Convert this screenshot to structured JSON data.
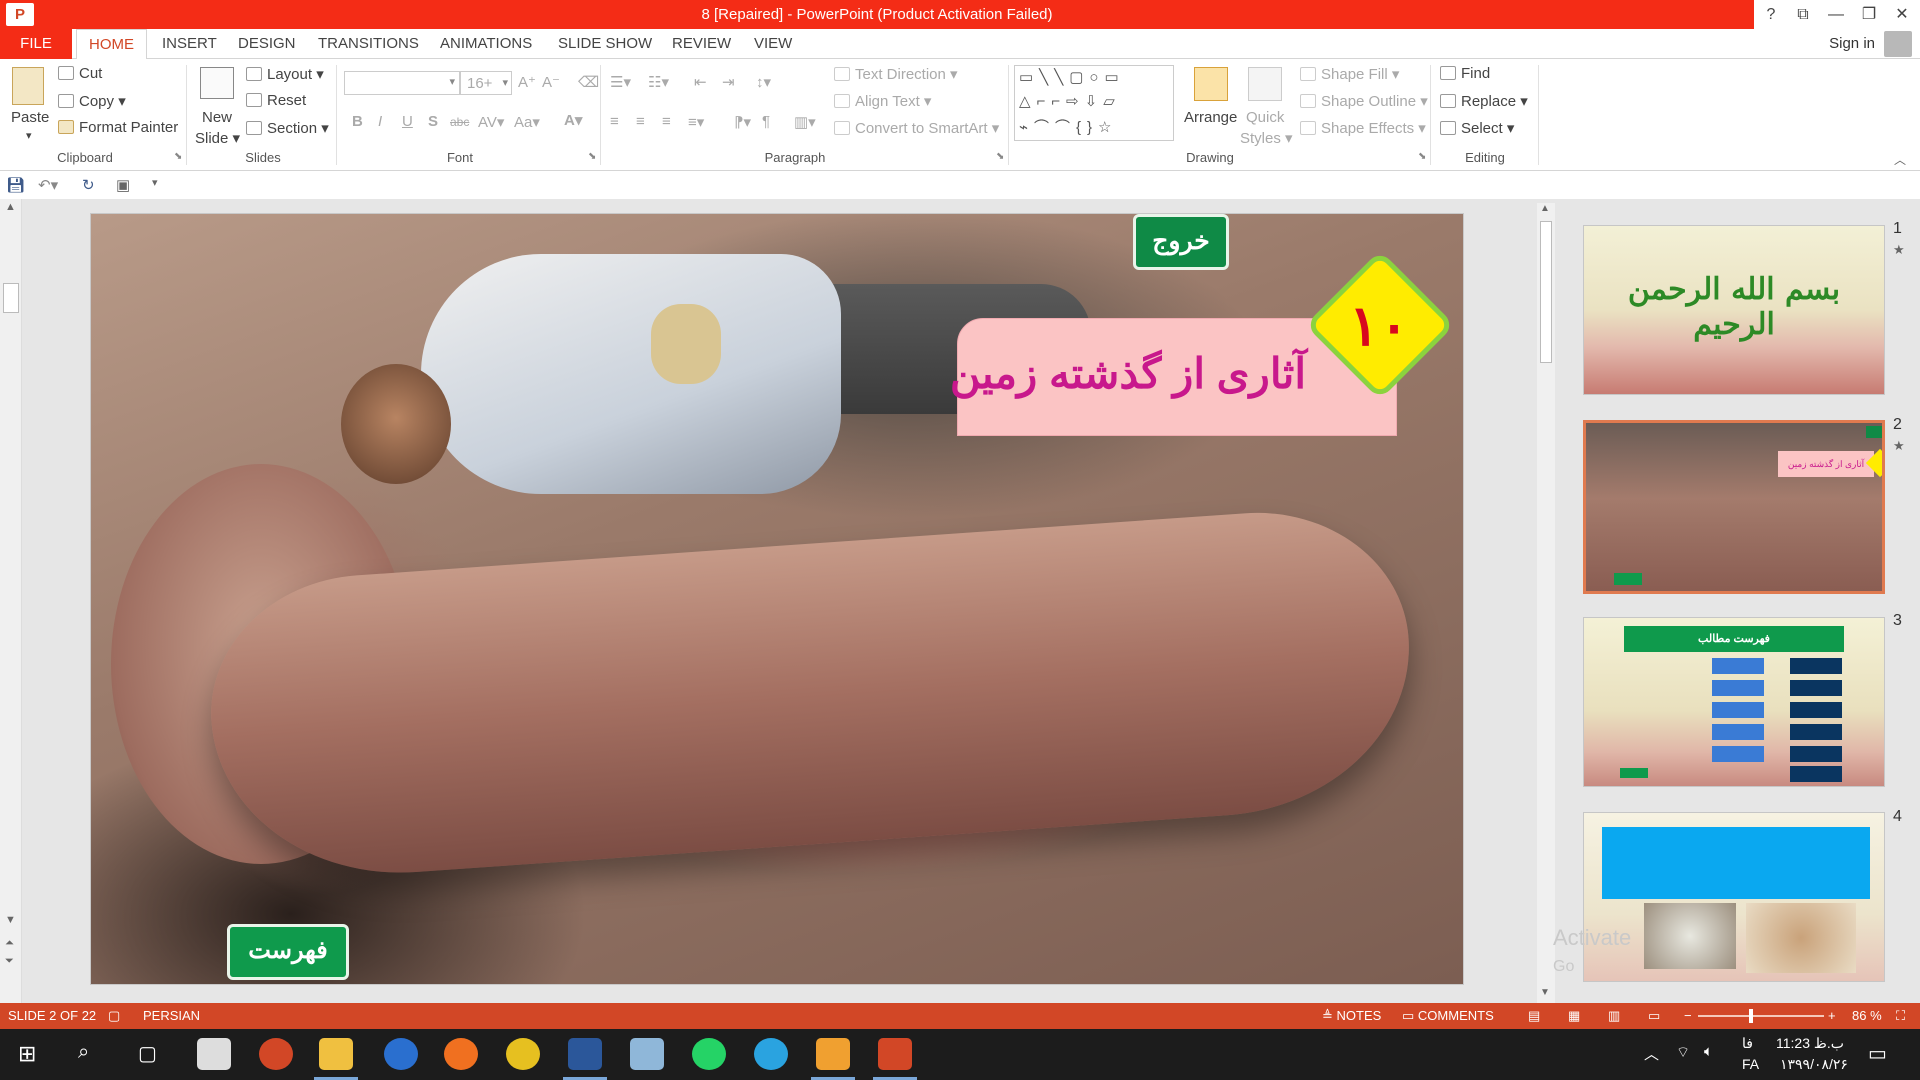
{
  "window": {
    "title": "8 [Repaired]  -  PowerPoint (Product Activation Failed)",
    "app_icon_letter": "P",
    "help": "?",
    "controls": [
      "⧉",
      "—",
      "❐",
      "✕"
    ]
  },
  "tabs": [
    "FILE",
    "HOME",
    "INSERT",
    "DESIGN",
    "TRANSITIONS",
    "ANIMATIONS",
    "SLIDE SHOW",
    "REVIEW",
    "VIEW"
  ],
  "account": {
    "signin": "Sign in"
  },
  "ribbon": {
    "clipboard": {
      "paste": "Paste",
      "cut": "Cut",
      "copy": "Copy",
      "format_painter": "Format Painter",
      "label": "Clipboard"
    },
    "slides": {
      "new_slide_1": "New",
      "new_slide_2": "Slide",
      "layout": "Layout",
      "reset": "Reset",
      "section": "Section",
      "label": "Slides"
    },
    "font": {
      "size": "16+",
      "label": "Font"
    },
    "paragraph": {
      "text_direction": "Text Direction",
      "align_text": "Align Text",
      "convert_smartart": "Convert to SmartArt",
      "label": "Paragraph"
    },
    "drawing": {
      "arrange": "Arrange",
      "quick_styles_1": "Quick",
      "quick_styles_2": "Styles",
      "shape_fill": "Shape Fill",
      "shape_outline": "Shape Outline",
      "shape_effects": "Shape Effects",
      "label": "Drawing"
    },
    "editing": {
      "find": "Find",
      "replace": "Replace",
      "select": "Select",
      "label": "Editing"
    }
  },
  "slide": {
    "exit_button": "خروج",
    "index_button": "فهرست",
    "title": "آثاری از گذشته زمین",
    "number": "۱۰"
  },
  "thumbnails": [
    {
      "num": "1",
      "text": "بسم الله الرحمن الرحيم"
    },
    {
      "num": "2",
      "text": "آثاری از گذشته زمین"
    },
    {
      "num": "3",
      "text": "فهرست مطالب"
    },
    {
      "num": "4",
      "text": ""
    }
  ],
  "watermark": {
    "line1": "Activate",
    "line2": "Go"
  },
  "status": {
    "slide": "SLIDE 2 OF 22",
    "language": "PERSIAN",
    "notes": "NOTES",
    "comments": "COMMENTS",
    "zoom": "86 %"
  },
  "tray": {
    "time": "11:23 ب.ظ",
    "date": "۱۳۹۹/۰۸/۲۶",
    "lang_top": "فا",
    "lang_bottom": "FA"
  },
  "colors": {
    "accent": "#d24726",
    "title_red": "#f42c16",
    "slide_green": "#0f8a46",
    "title_pink": "#fbc4c4",
    "title_text": "#c8188c",
    "diamond": "#ffec00"
  }
}
